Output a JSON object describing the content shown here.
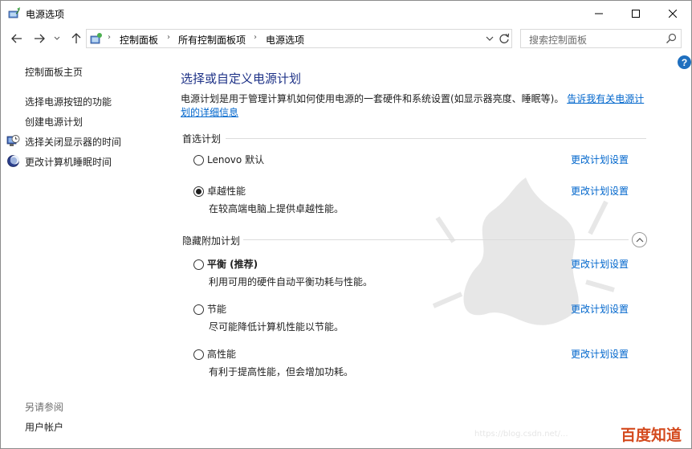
{
  "window": {
    "title": "电源选项",
    "minimize_icon": "minimize-icon",
    "maximize_icon": "maximize-icon",
    "close_icon": "close-icon"
  },
  "navigation": {
    "breadcrumbs": [
      "控制面板",
      "所有控制面板项",
      "电源选项"
    ],
    "search_placeholder": "搜索控制面板"
  },
  "help": {
    "label": "?"
  },
  "sidebar": {
    "home_link": "控制面板主页",
    "links": [
      {
        "label": "选择电源按钮的功能",
        "icon": null
      },
      {
        "label": "创建电源计划",
        "icon": null
      },
      {
        "label": "选择关闭显示器的时间",
        "icon": "display-clock-icon"
      },
      {
        "label": "更改计算机睡眠时间",
        "icon": "moon-sleep-icon"
      }
    ],
    "see_also": {
      "heading": "另请参阅",
      "links": [
        "用户帐户"
      ]
    }
  },
  "main": {
    "title": "选择或自定义电源计划",
    "description": "电源计划是用于管理计算机如何使用电源的一套硬件和系统设置(如显示器亮度、睡眠等)。",
    "description_link": "告诉我有关电源计划的详细信息",
    "preferred_label": "首选计划",
    "hidden_label": "隐藏附加计划",
    "preferred_plans": [
      {
        "name": "Lenovo 默认",
        "description": "",
        "selected": false,
        "bold": false,
        "change_link": "更改计划设置"
      },
      {
        "name": "卓越性能",
        "description": "在较高端电脑上提供卓越性能。",
        "selected": true,
        "bold": false,
        "change_link": "更改计划设置"
      }
    ],
    "hidden_plans": [
      {
        "name": "平衡 (推荐)",
        "description": "利用可用的硬件自动平衡功耗与性能。",
        "selected": false,
        "bold": true,
        "change_link": "更改计划设置"
      },
      {
        "name": "节能",
        "description": "尽可能降低计算机性能以节能。",
        "selected": false,
        "bold": false,
        "change_link": "更改计划设置"
      },
      {
        "name": "高性能",
        "description": "有利于提高性能，但会增加功耗。",
        "selected": false,
        "bold": false,
        "change_link": "更改计划设置"
      }
    ]
  },
  "watermark": {
    "brand": "百度知道",
    "url": "https://blog.csdn.net/..."
  }
}
